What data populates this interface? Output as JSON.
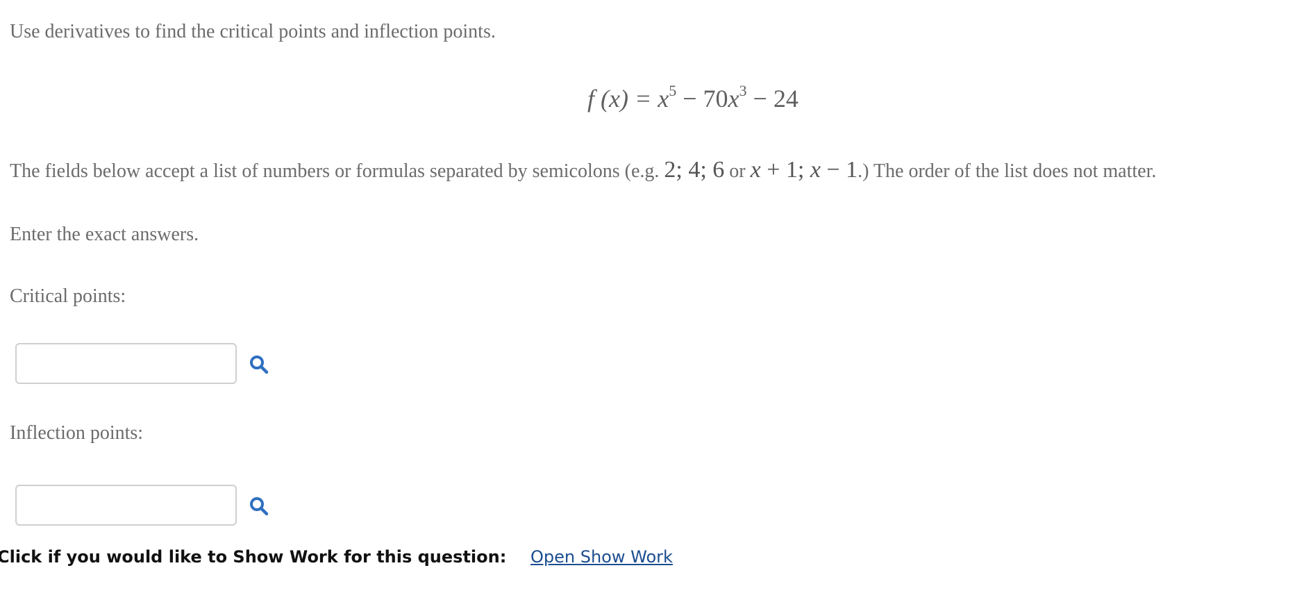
{
  "question": {
    "intro": "Use derivatives to find the critical points and inflection points.",
    "equation": {
      "lhs": "f (x) = ",
      "term1_base": "x",
      "term1_exp": "5",
      "term2_coef": " − 70",
      "term2_base": "x",
      "term2_exp": "3",
      "term3": " − 24"
    },
    "instructions_before": "The fields below accept a list of numbers or formulas separated by semicolons (e.g. ",
    "example1": "2;  4;  6",
    "instructions_or": " or ",
    "example2_part1": "x",
    "example2_part2": " + 1;  ",
    "example2_part3": "x",
    "example2_part4": " − 1",
    "instructions_after": ".) The order of the list does not matter.",
    "exact_note": "Enter the exact answers."
  },
  "fields": {
    "critical_label": "Critical points:",
    "critical_value": "",
    "inflection_label": "Inflection points:",
    "inflection_value": ""
  },
  "show_work": {
    "prompt": "Click if you would like to Show Work for this question:",
    "link_label": "Open Show Work"
  },
  "icons": {
    "search": "search-icon",
    "accent_color": "#2f6fc0"
  }
}
